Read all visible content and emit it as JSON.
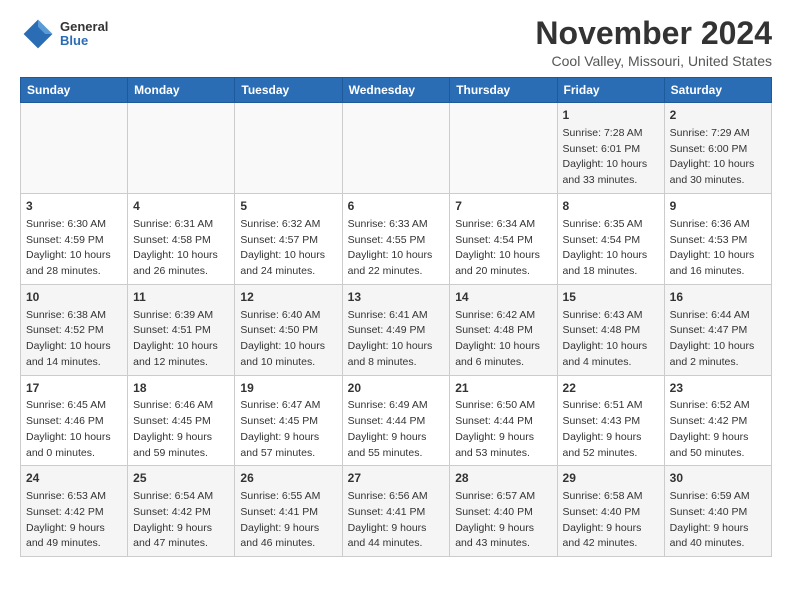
{
  "header": {
    "logo_general": "General",
    "logo_blue": "Blue",
    "month_title": "November 2024",
    "location": "Cool Valley, Missouri, United States"
  },
  "weekdays": [
    "Sunday",
    "Monday",
    "Tuesday",
    "Wednesday",
    "Thursday",
    "Friday",
    "Saturday"
  ],
  "weeks": [
    [
      {
        "day": "",
        "info": ""
      },
      {
        "day": "",
        "info": ""
      },
      {
        "day": "",
        "info": ""
      },
      {
        "day": "",
        "info": ""
      },
      {
        "day": "",
        "info": ""
      },
      {
        "day": "1",
        "info": "Sunrise: 7:28 AM\nSunset: 6:01 PM\nDaylight: 10 hours\nand 33 minutes."
      },
      {
        "day": "2",
        "info": "Sunrise: 7:29 AM\nSunset: 6:00 PM\nDaylight: 10 hours\nand 30 minutes."
      }
    ],
    [
      {
        "day": "3",
        "info": "Sunrise: 6:30 AM\nSunset: 4:59 PM\nDaylight: 10 hours\nand 28 minutes."
      },
      {
        "day": "4",
        "info": "Sunrise: 6:31 AM\nSunset: 4:58 PM\nDaylight: 10 hours\nand 26 minutes."
      },
      {
        "day": "5",
        "info": "Sunrise: 6:32 AM\nSunset: 4:57 PM\nDaylight: 10 hours\nand 24 minutes."
      },
      {
        "day": "6",
        "info": "Sunrise: 6:33 AM\nSunset: 4:55 PM\nDaylight: 10 hours\nand 22 minutes."
      },
      {
        "day": "7",
        "info": "Sunrise: 6:34 AM\nSunset: 4:54 PM\nDaylight: 10 hours\nand 20 minutes."
      },
      {
        "day": "8",
        "info": "Sunrise: 6:35 AM\nSunset: 4:54 PM\nDaylight: 10 hours\nand 18 minutes."
      },
      {
        "day": "9",
        "info": "Sunrise: 6:36 AM\nSunset: 4:53 PM\nDaylight: 10 hours\nand 16 minutes."
      }
    ],
    [
      {
        "day": "10",
        "info": "Sunrise: 6:38 AM\nSunset: 4:52 PM\nDaylight: 10 hours\nand 14 minutes."
      },
      {
        "day": "11",
        "info": "Sunrise: 6:39 AM\nSunset: 4:51 PM\nDaylight: 10 hours\nand 12 minutes."
      },
      {
        "day": "12",
        "info": "Sunrise: 6:40 AM\nSunset: 4:50 PM\nDaylight: 10 hours\nand 10 minutes."
      },
      {
        "day": "13",
        "info": "Sunrise: 6:41 AM\nSunset: 4:49 PM\nDaylight: 10 hours\nand 8 minutes."
      },
      {
        "day": "14",
        "info": "Sunrise: 6:42 AM\nSunset: 4:48 PM\nDaylight: 10 hours\nand 6 minutes."
      },
      {
        "day": "15",
        "info": "Sunrise: 6:43 AM\nSunset: 4:48 PM\nDaylight: 10 hours\nand 4 minutes."
      },
      {
        "day": "16",
        "info": "Sunrise: 6:44 AM\nSunset: 4:47 PM\nDaylight: 10 hours\nand 2 minutes."
      }
    ],
    [
      {
        "day": "17",
        "info": "Sunrise: 6:45 AM\nSunset: 4:46 PM\nDaylight: 10 hours\nand 0 minutes."
      },
      {
        "day": "18",
        "info": "Sunrise: 6:46 AM\nSunset: 4:45 PM\nDaylight: 9 hours\nand 59 minutes."
      },
      {
        "day": "19",
        "info": "Sunrise: 6:47 AM\nSunset: 4:45 PM\nDaylight: 9 hours\nand 57 minutes."
      },
      {
        "day": "20",
        "info": "Sunrise: 6:49 AM\nSunset: 4:44 PM\nDaylight: 9 hours\nand 55 minutes."
      },
      {
        "day": "21",
        "info": "Sunrise: 6:50 AM\nSunset: 4:44 PM\nDaylight: 9 hours\nand 53 minutes."
      },
      {
        "day": "22",
        "info": "Sunrise: 6:51 AM\nSunset: 4:43 PM\nDaylight: 9 hours\nand 52 minutes."
      },
      {
        "day": "23",
        "info": "Sunrise: 6:52 AM\nSunset: 4:42 PM\nDaylight: 9 hours\nand 50 minutes."
      }
    ],
    [
      {
        "day": "24",
        "info": "Sunrise: 6:53 AM\nSunset: 4:42 PM\nDaylight: 9 hours\nand 49 minutes."
      },
      {
        "day": "25",
        "info": "Sunrise: 6:54 AM\nSunset: 4:42 PM\nDaylight: 9 hours\nand 47 minutes."
      },
      {
        "day": "26",
        "info": "Sunrise: 6:55 AM\nSunset: 4:41 PM\nDaylight: 9 hours\nand 46 minutes."
      },
      {
        "day": "27",
        "info": "Sunrise: 6:56 AM\nSunset: 4:41 PM\nDaylight: 9 hours\nand 44 minutes."
      },
      {
        "day": "28",
        "info": "Sunrise: 6:57 AM\nSunset: 4:40 PM\nDaylight: 9 hours\nand 43 minutes."
      },
      {
        "day": "29",
        "info": "Sunrise: 6:58 AM\nSunset: 4:40 PM\nDaylight: 9 hours\nand 42 minutes."
      },
      {
        "day": "30",
        "info": "Sunrise: 6:59 AM\nSunset: 4:40 PM\nDaylight: 9 hours\nand 40 minutes."
      }
    ]
  ]
}
